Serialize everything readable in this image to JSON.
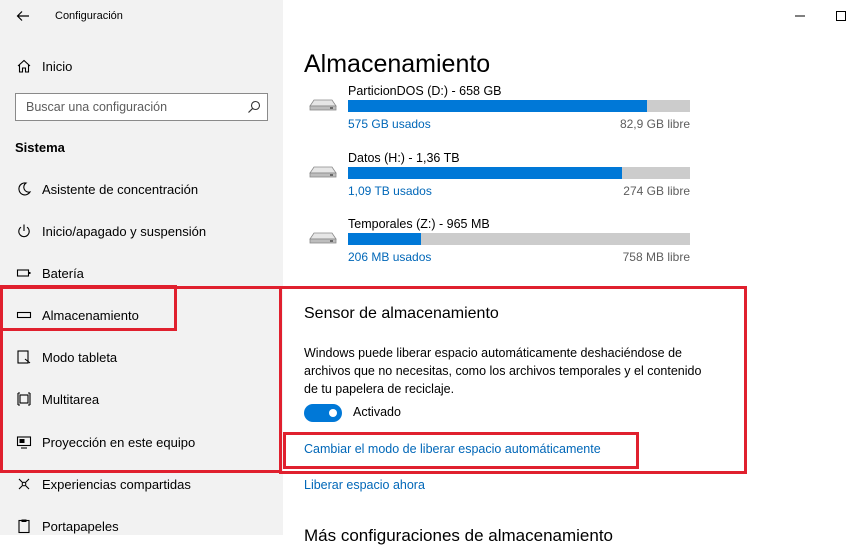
{
  "window": {
    "title": "Configuración",
    "back_icon": "back-arrow-icon",
    "controls": [
      "minimize-icon",
      "maximize-icon"
    ]
  },
  "sidebar": {
    "home": {
      "label": "Inicio",
      "icon": "home-icon"
    },
    "search": {
      "placeholder": "Buscar una configuración",
      "value": "",
      "icon": "search-icon"
    },
    "section": "Sistema",
    "items": [
      {
        "label": "Asistente de concentración",
        "icon": "moon-icon"
      },
      {
        "label": "Inicio/apagado y suspensión",
        "icon": "power-icon"
      },
      {
        "label": "Batería",
        "icon": "battery-icon"
      },
      {
        "label": "Almacenamiento",
        "icon": "storage-icon"
      },
      {
        "label": "Modo tableta",
        "icon": "tablet-icon"
      },
      {
        "label": "Multitarea",
        "icon": "multitask-icon"
      },
      {
        "label": "Proyección en este equipo",
        "icon": "projection-icon"
      },
      {
        "label": "Experiencias compartidas",
        "icon": "shared-icon"
      },
      {
        "label": "Portapapeles",
        "icon": "clipboard-icon"
      }
    ]
  },
  "main": {
    "title": "Almacenamiento",
    "drives": [
      {
        "name": "ParticionDOS (D:) - 658 GB",
        "used": "575 GB usados",
        "free": "82,9 GB libre",
        "used_fraction": 0.874
      },
      {
        "name": "Datos (H:) - 1,36 TB",
        "used": "1,09 TB usados",
        "free": "274 GB libre",
        "used_fraction": 0.8
      },
      {
        "name": "Temporales (Z:) - 965 MB",
        "used": "206 MB usados",
        "free": "758 MB libre",
        "used_fraction": 0.213
      }
    ],
    "sensor": {
      "title": "Sensor de almacenamiento",
      "description": "Windows puede liberar espacio automáticamente deshaciéndose de archivos que no necesitas, como los archivos temporales y el contenido de tu papelera de reciclaje.",
      "toggle_on": true,
      "toggle_label": "Activado",
      "change_link": "Cambiar el modo de liberar espacio automáticamente",
      "free_link": "Liberar espacio ahora"
    },
    "next_heading": "Más configuraciones de almacenamiento"
  },
  "colors": {
    "accent": "#0078d7",
    "link": "#0067b8",
    "sidebar_bg": "#f2f2f2",
    "annotation": "#e0202e"
  }
}
